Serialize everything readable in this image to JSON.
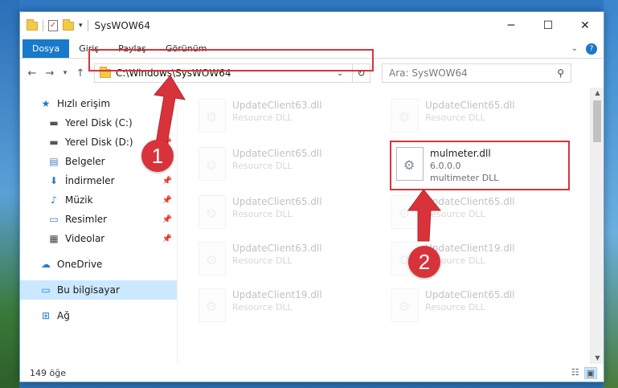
{
  "window": {
    "title": "SysWOW64",
    "minimize": "─",
    "maximize": "☐",
    "close": "✕",
    "qat_arrow": "▾",
    "prop_glyph": "✓"
  },
  "ribbon": {
    "tabs": [
      "Dosya",
      "Giriş",
      "Paylaş",
      "Görünüm"
    ],
    "help": "?"
  },
  "nav": {
    "back": "←",
    "forward": "→",
    "recent": "▾",
    "up": "↑",
    "address": "C:\\Windows\\SysWOW64",
    "address_chevron": "⌄",
    "refresh": "↻",
    "search_placeholder": "Ara: SysWOW64",
    "search_icon": "⚲"
  },
  "sidebar": {
    "items": [
      {
        "label": "Hızlı erişim",
        "icon": "star-icon"
      },
      {
        "label": "Yerel Disk (C:)",
        "icon": "drive-icon",
        "pinned": true
      },
      {
        "label": "Yerel Disk (D:)",
        "icon": "drive-icon",
        "pinned": true
      },
      {
        "label": "Belgeler",
        "icon": "documents-icon",
        "pinned": true
      },
      {
        "label": "İndirmeler",
        "icon": "download-icon",
        "pinned": true
      },
      {
        "label": "Müzik",
        "icon": "music-icon",
        "pinned": true
      },
      {
        "label": "Resimler",
        "icon": "pictures-icon",
        "pinned": true
      },
      {
        "label": "Videolar",
        "icon": "videos-icon",
        "pinned": true
      },
      {
        "label": "OneDrive",
        "icon": "cloud-icon"
      },
      {
        "label": "Bu bilgisayar",
        "icon": "computer-icon",
        "selected": true
      },
      {
        "label": "Ağ",
        "icon": "network-icon"
      }
    ]
  },
  "files": [
    {
      "name": "UpdateClient63.dll",
      "desc": "Resource DLL",
      "faded": true
    },
    {
      "name": "UpdateClient65.dll",
      "desc": "Resource DLL",
      "faded": true
    },
    {
      "name": "UpdateClient65.dll",
      "desc": "Resource DLL",
      "faded": true
    },
    {
      "name": "mulmeter.dll",
      "version": "6.0.0.0",
      "desc": "multimeter DLL",
      "faded": false
    },
    {
      "name": "UpdateClient65.dll",
      "desc": "Resource DLL",
      "faded": true
    },
    {
      "name": "UpdateClient65.dll",
      "desc": "Resource DLL",
      "faded": true
    },
    {
      "name": "UpdateClient63.dll",
      "desc": "Resource DLL",
      "faded": true
    },
    {
      "name": "UpdateClient19.dll",
      "desc": "Resource DLL",
      "faded": true
    },
    {
      "name": "UpdateClient19.dll",
      "desc": "Resource DLL",
      "faded": true
    },
    {
      "name": "UpdateClient65.dll",
      "desc": "Resource DLL",
      "faded": true
    }
  ],
  "status": {
    "count": "149 öğe"
  },
  "annotations": {
    "badge1": "1",
    "badge2": "2",
    "color": "#d8333a"
  }
}
